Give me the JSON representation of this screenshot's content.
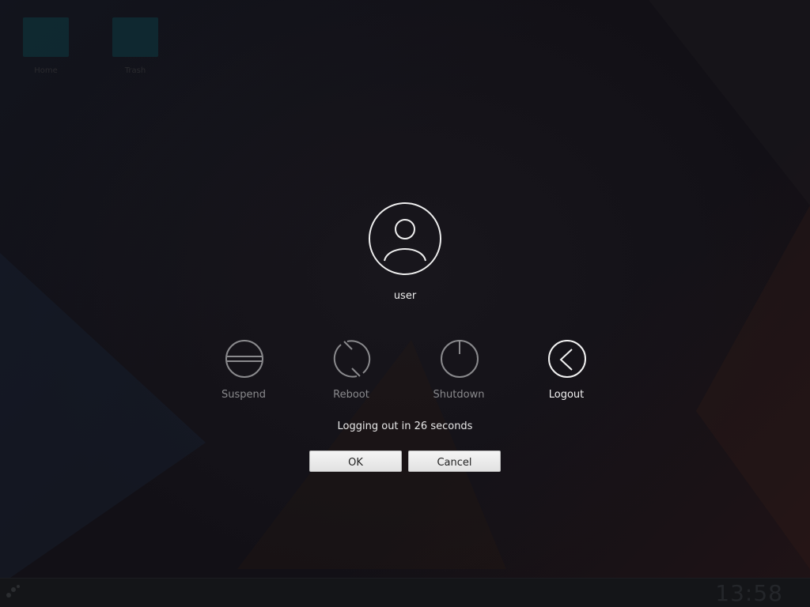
{
  "desktop": {
    "icons": [
      {
        "name": "Home"
      },
      {
        "name": "Trash"
      }
    ]
  },
  "dialog": {
    "username": "user",
    "actions": [
      {
        "label": "Suspend",
        "icon": "suspend-icon",
        "active": false
      },
      {
        "label": "Reboot",
        "icon": "reboot-icon",
        "active": false
      },
      {
        "label": "Shutdown",
        "icon": "power-icon",
        "active": false
      },
      {
        "label": "Logout",
        "icon": "logout-icon",
        "active": true
      }
    ],
    "countdown_text": "Logging out in 26 seconds",
    "ok_label": "OK",
    "cancel_label": "Cancel"
  },
  "taskbar": {
    "clock": "13:58"
  },
  "colors": {
    "active": "#f2f2f2",
    "inactive": "#8a8a8d"
  }
}
